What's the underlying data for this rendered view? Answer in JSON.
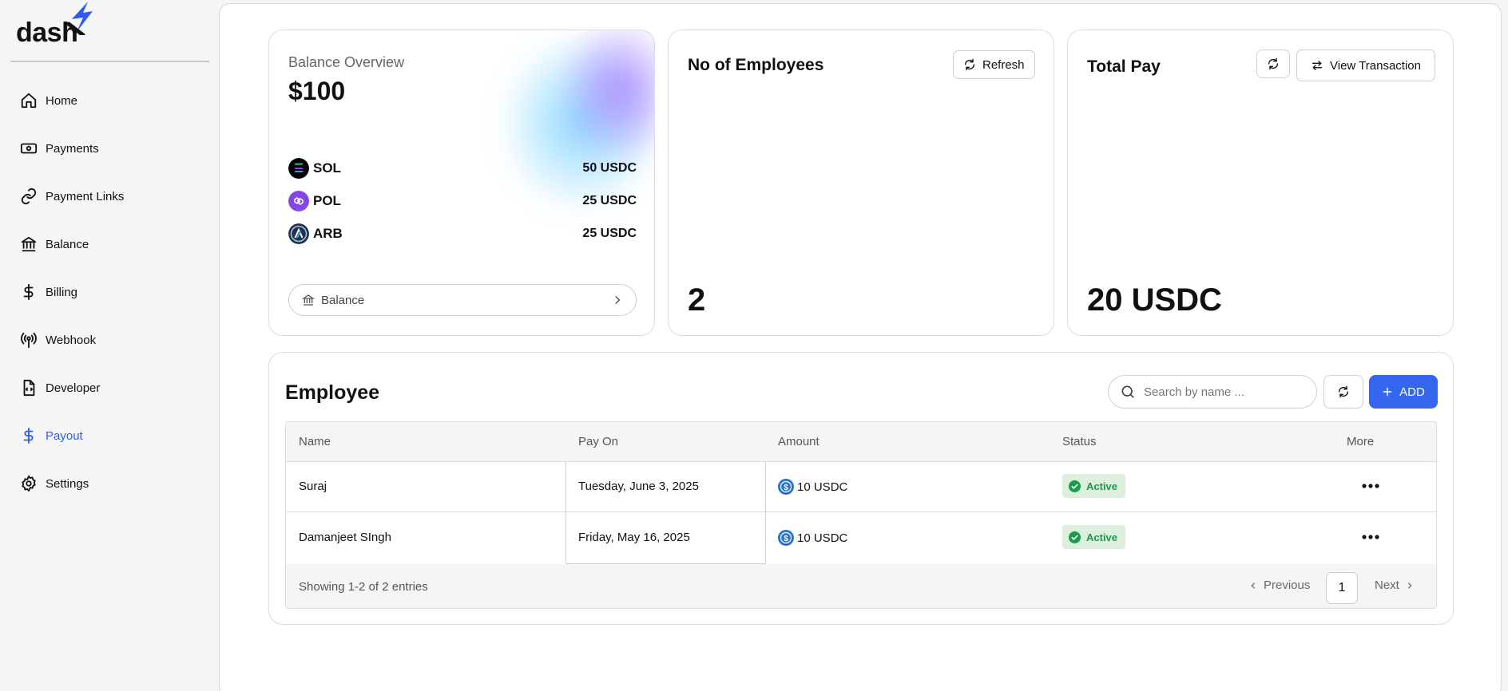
{
  "brand": {
    "name": "dash",
    "accent": "#2f5cf0"
  },
  "sidebar": {
    "items": [
      {
        "label": "Home",
        "icon": "home-icon"
      },
      {
        "label": "Payments",
        "icon": "payments-icon"
      },
      {
        "label": "Payment Links",
        "icon": "link-icon"
      },
      {
        "label": "Balance",
        "icon": "bank-icon"
      },
      {
        "label": "Billing",
        "icon": "dollar-icon"
      },
      {
        "label": "Webhook",
        "icon": "broadcast-icon"
      },
      {
        "label": "Developer",
        "icon": "code-file-icon"
      },
      {
        "label": "Payout",
        "icon": "dollar-icon",
        "active": true
      },
      {
        "label": "Settings",
        "icon": "gear-icon"
      }
    ]
  },
  "balance_card": {
    "title": "Balance Overview",
    "amount": "$100",
    "tokens": [
      {
        "name": "SOL",
        "value": "50 USDC"
      },
      {
        "name": "POL",
        "value": "25 USDC"
      },
      {
        "name": "ARB",
        "value": "25 USDC"
      }
    ],
    "button_label": "Balance"
  },
  "employees_card": {
    "title": "No of Employees",
    "refresh_label": "Refresh",
    "count": "2"
  },
  "total_pay_card": {
    "title": "Total Pay",
    "view_label": "View Transaction",
    "amount": "20 USDC"
  },
  "employee_table": {
    "title": "Employee",
    "search_placeholder": "Search by name ...",
    "add_label": "ADD",
    "columns": [
      "Name",
      "Pay On",
      "Amount",
      "Status",
      "More"
    ],
    "rows": [
      {
        "name": "Suraj",
        "pay_on": "Tuesday, June 3, 2025",
        "amount": "10 USDC",
        "status": "Active"
      },
      {
        "name": "Damanjeet SIngh",
        "pay_on": "Friday, May 16, 2025",
        "amount": "10 USDC",
        "status": "Active"
      }
    ],
    "footer": "Showing 1-2 of 2 entries",
    "pager": {
      "prev": "Previous",
      "page": "1",
      "next": "Next"
    }
  }
}
